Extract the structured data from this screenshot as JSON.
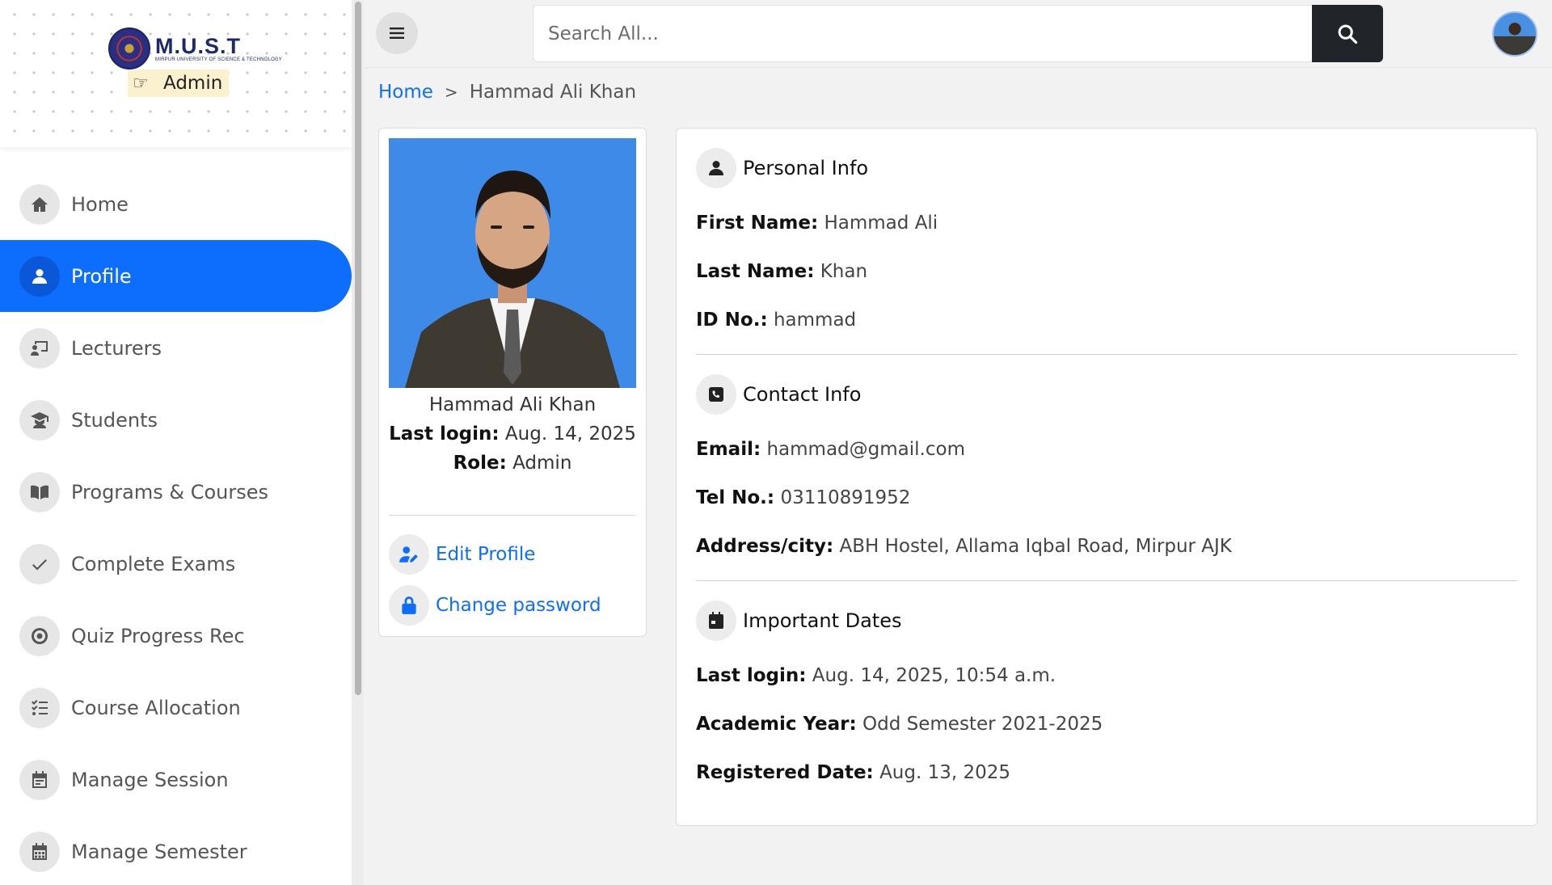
{
  "brand": {
    "title": "M.U.S.T",
    "subtitle": "MIRPUR UNIVERSITY OF SCIENCE & TECHNOLOGY",
    "role_badge": "Admin"
  },
  "sidebar": {
    "active_color": "#0d6efd",
    "items": [
      {
        "label": "Home",
        "icon": "home-icon",
        "active": false
      },
      {
        "label": "Profile",
        "icon": "user-icon",
        "active": true
      },
      {
        "label": "Lecturers",
        "icon": "lecturer-board-icon",
        "active": false
      },
      {
        "label": "Students",
        "icon": "graduate-icon",
        "active": false
      },
      {
        "label": "Programs & Courses",
        "icon": "book-icon",
        "active": false
      },
      {
        "label": "Complete Exams",
        "icon": "check-icon",
        "active": false
      },
      {
        "label": "Quiz Progress Rec",
        "icon": "record-icon",
        "active": false
      },
      {
        "label": "Course Allocation",
        "icon": "list-check-icon",
        "active": false
      },
      {
        "label": "Manage Session",
        "icon": "calendar-icon",
        "active": false
      },
      {
        "label": "Manage Semester",
        "icon": "calendar-grid-icon",
        "active": false
      }
    ]
  },
  "topbar": {
    "search_placeholder": "Search All..."
  },
  "breadcrumb": {
    "home": "Home",
    "separator": ">",
    "current": "Hammad Ali Khan"
  },
  "profile_card": {
    "name": "Hammad Ali Khan",
    "last_login_label": "Last login:",
    "last_login_value": "Aug. 14, 2025",
    "role_label": "Role:",
    "role_value": "Admin",
    "edit_profile": "Edit Profile",
    "change_password": "Change password"
  },
  "personal_info": {
    "title": "Personal Info",
    "first_name_label": "First Name:",
    "first_name": "Hammad Ali",
    "last_name_label": "Last Name:",
    "last_name": "Khan",
    "id_label": "ID No.:",
    "id": "hammad"
  },
  "contact_info": {
    "title": "Contact Info",
    "email_label": "Email:",
    "email": "hammad@gmail.com",
    "tel_label": "Tel No.:",
    "tel": "03110891952",
    "address_label": "Address/city:",
    "address": "ABH Hostel, Allama Iqbal Road, Mirpur AJK"
  },
  "important_dates": {
    "title": "Important Dates",
    "last_login_label": "Last login:",
    "last_login": "Aug. 14, 2025, 10:54 a.m.",
    "academic_year_label": "Academic Year:",
    "academic_year": "Odd Semester 2021-2025",
    "registered_label": "Registered Date:",
    "registered": "Aug. 13, 2025"
  }
}
